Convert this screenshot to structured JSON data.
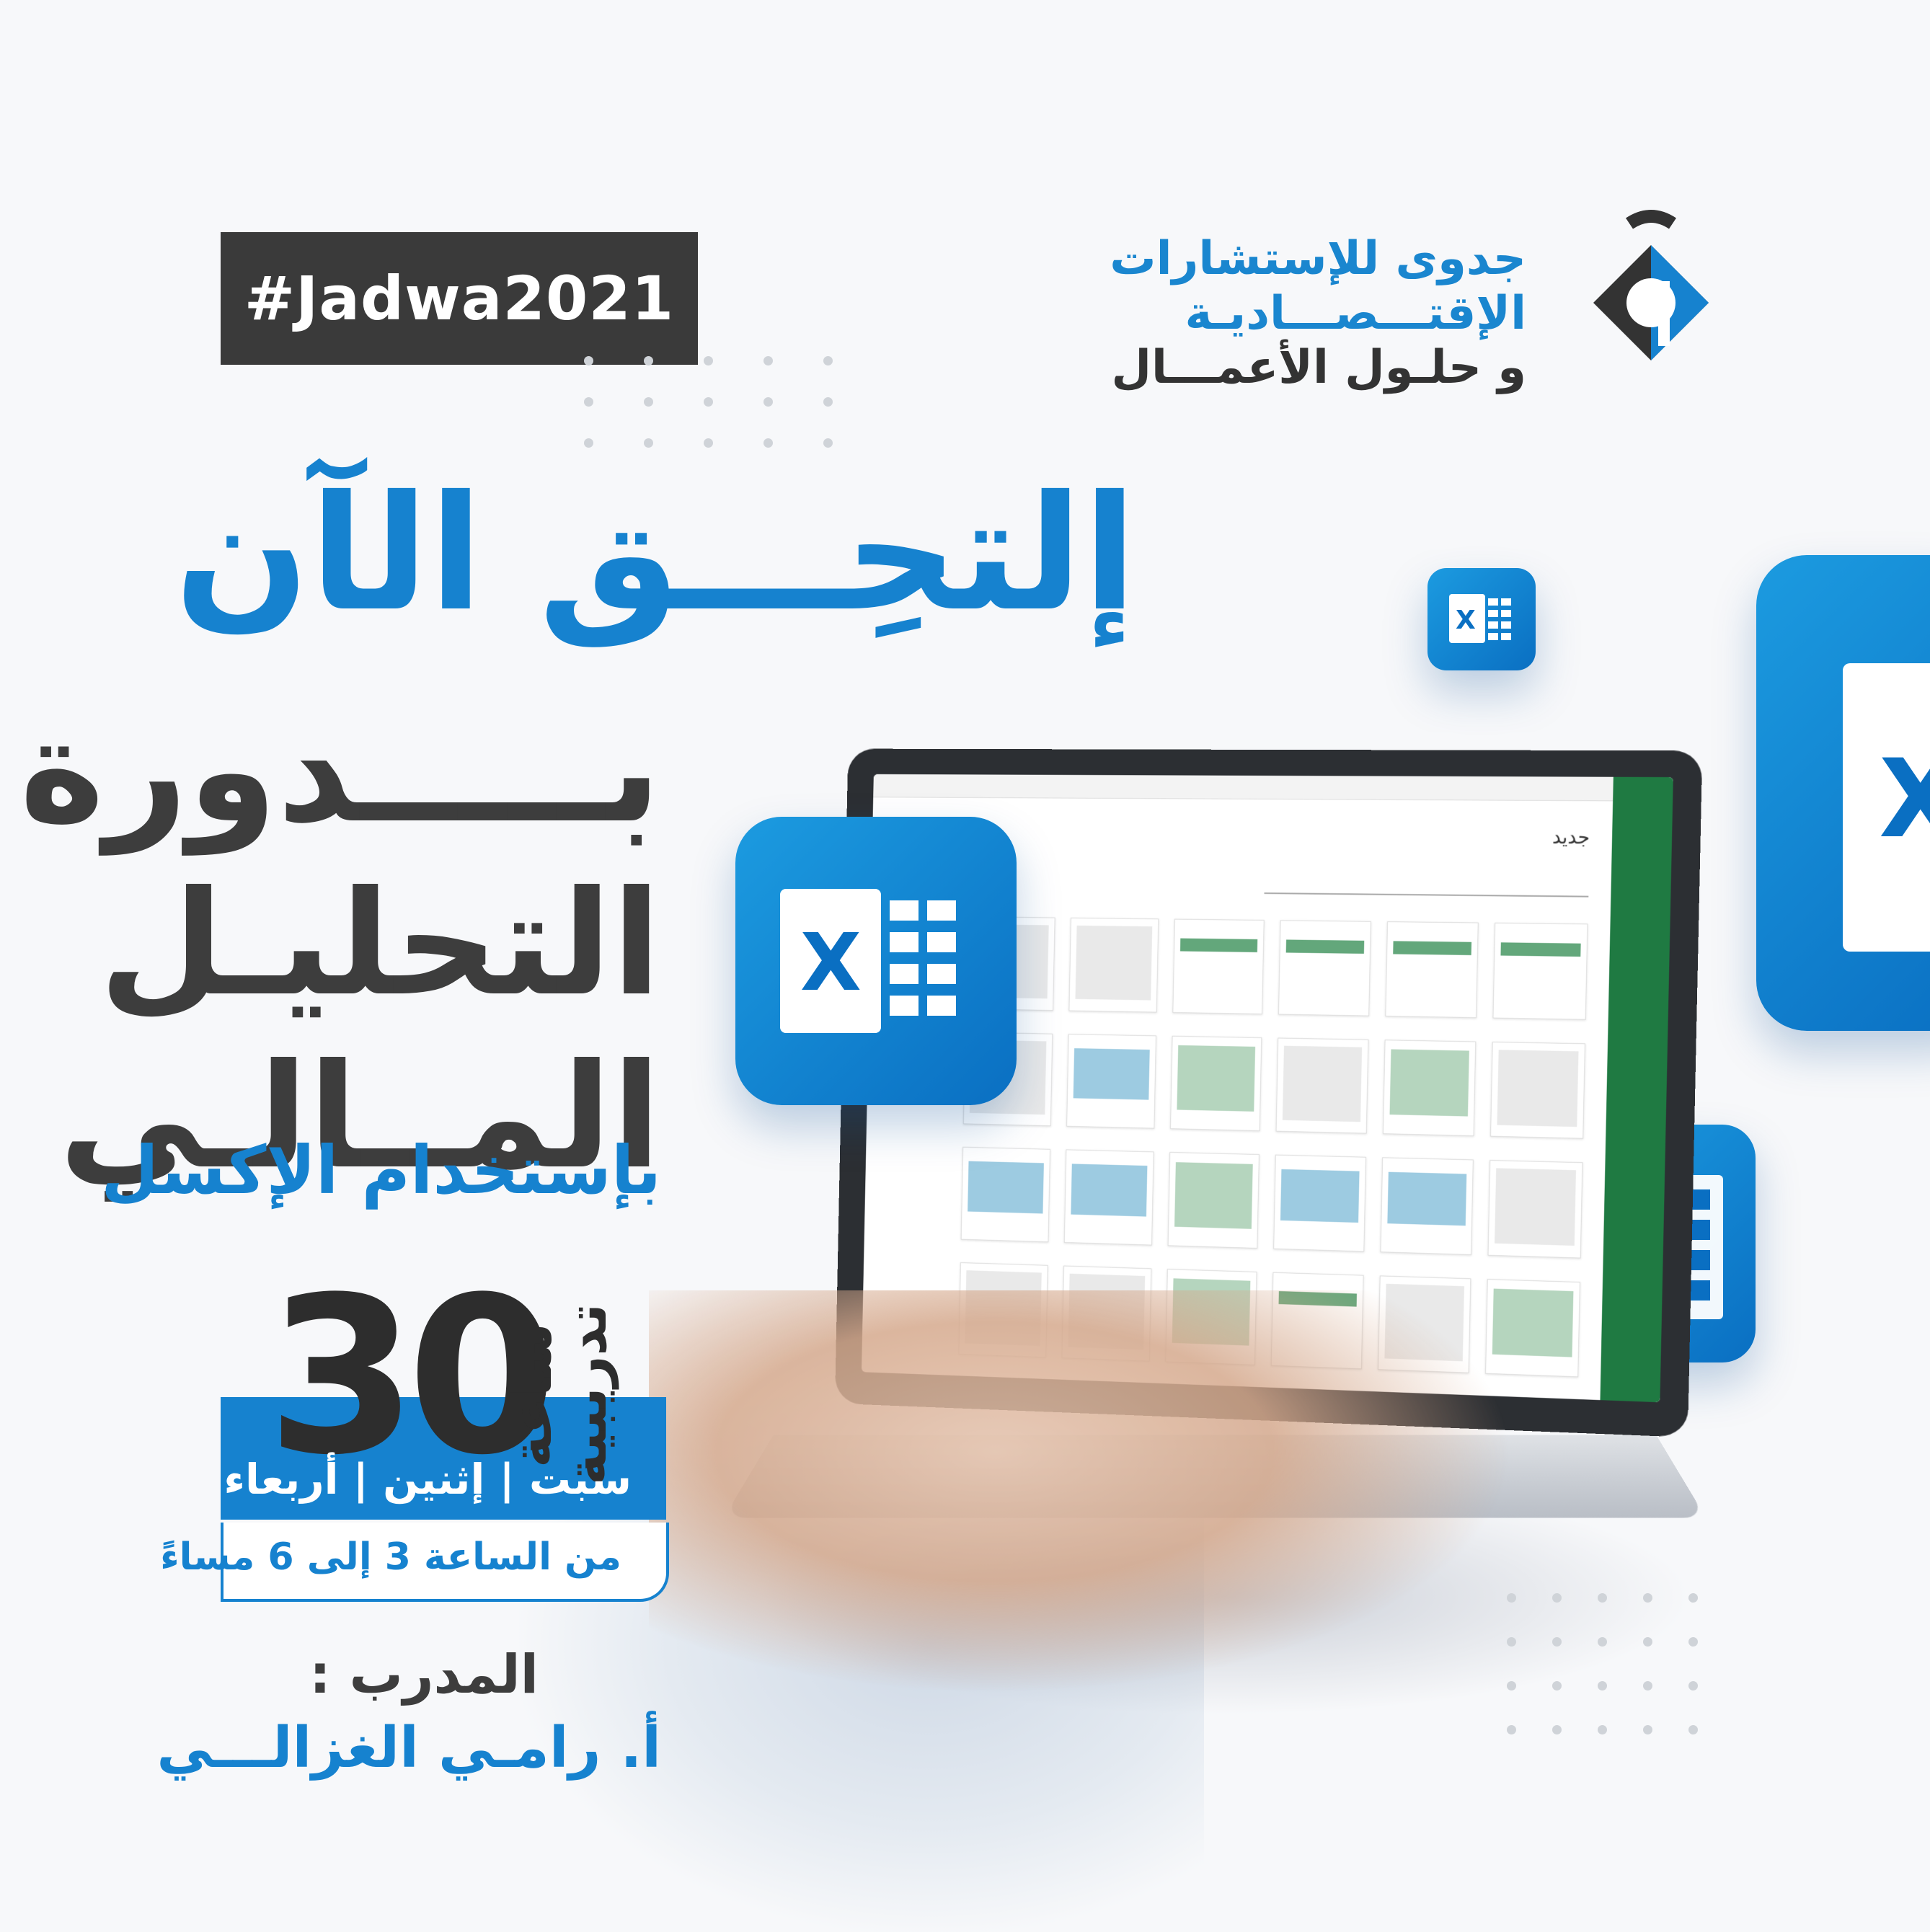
{
  "hashtag": "#Jadwa2021",
  "logo": {
    "line1": "جدوى للإستشارات",
    "line2": "الإقتـــصـــاديـة",
    "line3": "و حلـول الأعمـــال",
    "icon": "jadwa-logo-icon"
  },
  "headline": "إلتحِـــق الآن",
  "course": {
    "line1": "بـــــدورة",
    "line2": "التحليـل",
    "line3": "المــالـي",
    "subtitle": "بإستخدام الإكسل"
  },
  "schedule": {
    "hours_number": "30",
    "hours_label": "ساعة تدريبية",
    "days": "سبت | إثنين | أربعاء",
    "time": "من الساعة 3 إلى 6 مساءً"
  },
  "trainer": {
    "label": "المدرب :",
    "name": "أ. رامـي الغزالـــي"
  },
  "screen": {
    "app_new_label": "جديد"
  },
  "colors": {
    "brand_blue": "#1682cf",
    "dark": "#3d3d3d",
    "excel_green": "#1f7a42"
  },
  "icons": [
    "excel-icon"
  ]
}
